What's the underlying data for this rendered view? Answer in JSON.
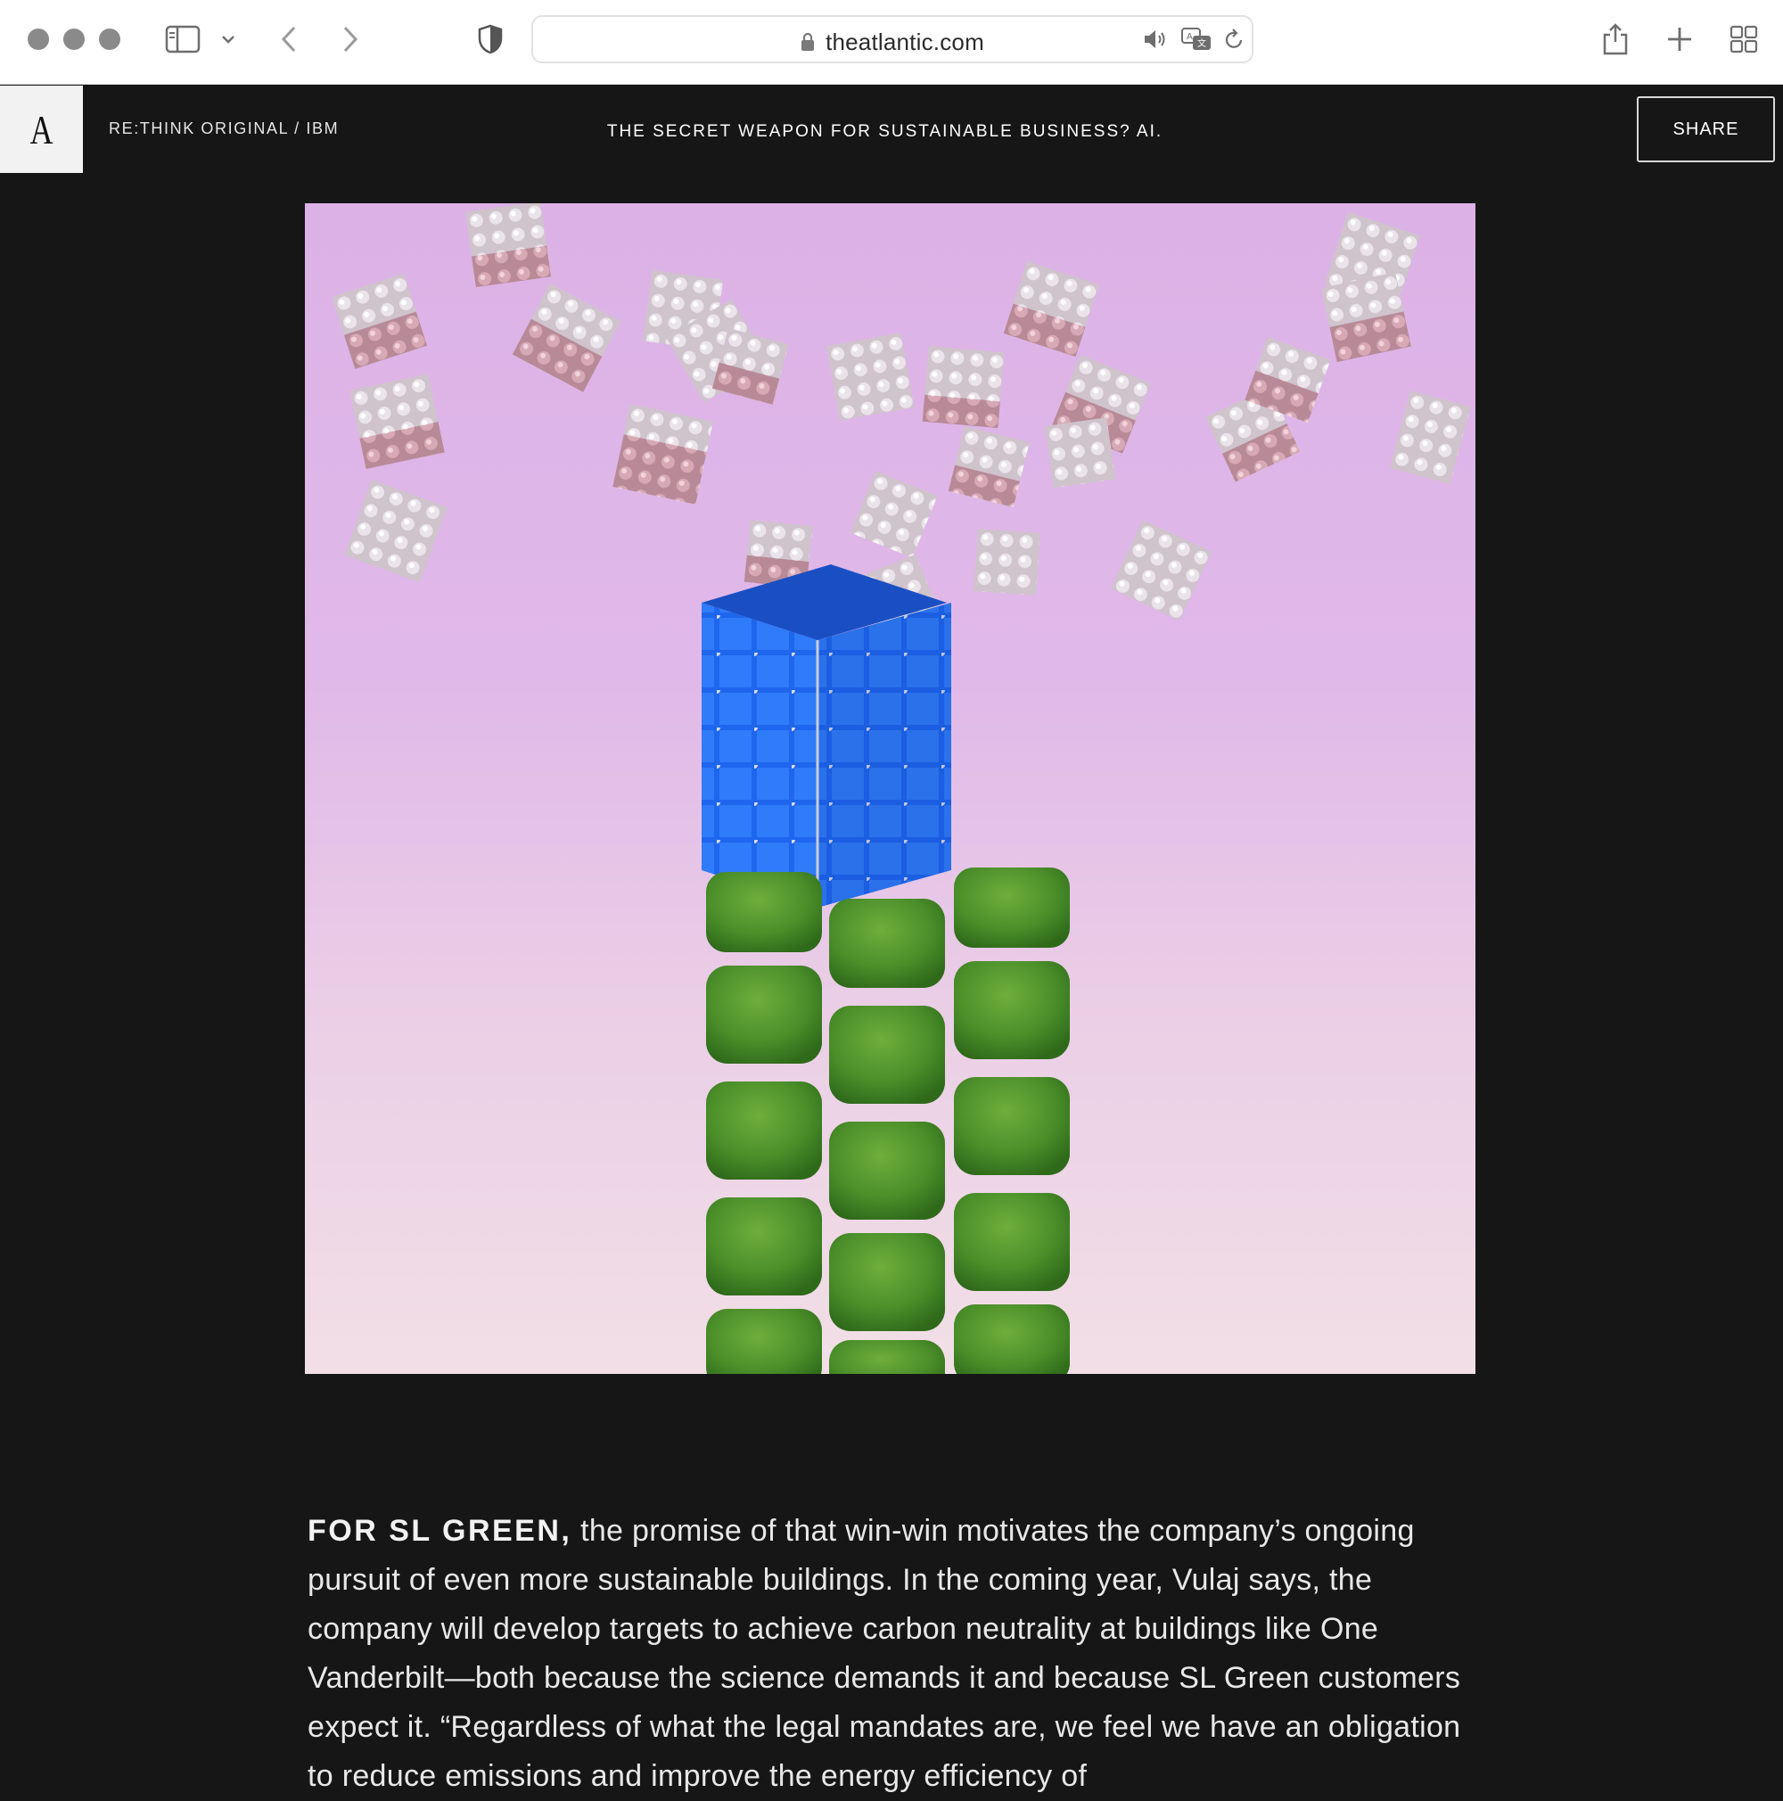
{
  "browser": {
    "url": "theatlantic.com",
    "icons": [
      "traffic-light-icons",
      "sidebar-icon",
      "chevron-down-icon",
      "back-icon",
      "forward-icon",
      "privacy-shield-icon",
      "lock-icon",
      "speaker-icon",
      "translate-icon",
      "reload-icon",
      "share-icon",
      "new-tab-icon",
      "tab-overview-icon"
    ]
  },
  "site": {
    "logo": "A",
    "series": "RE:THINK ORIGINAL / IBM",
    "headline": "THE SECRET WEAPON FOR SUSTAINABLE BUSINESS? AI.",
    "share_label": "SHARE"
  },
  "article": {
    "lead_in": "FOR SL GREEN,",
    "body": " the promise of that win-win motivates the company’s ongoing pursuit of even more sustainable buildings. In the coming year, Vulaj says, the company will develop targets to achieve carbon neutrality at buildings like One Vanderbilt—both because the science demands it and because SL Green customers expect it. “Regardless of what the legal mandates are, we feel we have an obligation to reduce emissions and improve the energy efficiency of"
  },
  "colors": {
    "page_bg": "#161616",
    "sky_top": "#dcb2e6",
    "sky_bottom": "#f2dfe6",
    "blue_cube": "#1f6bf0",
    "grass": "#4b8f2a"
  }
}
